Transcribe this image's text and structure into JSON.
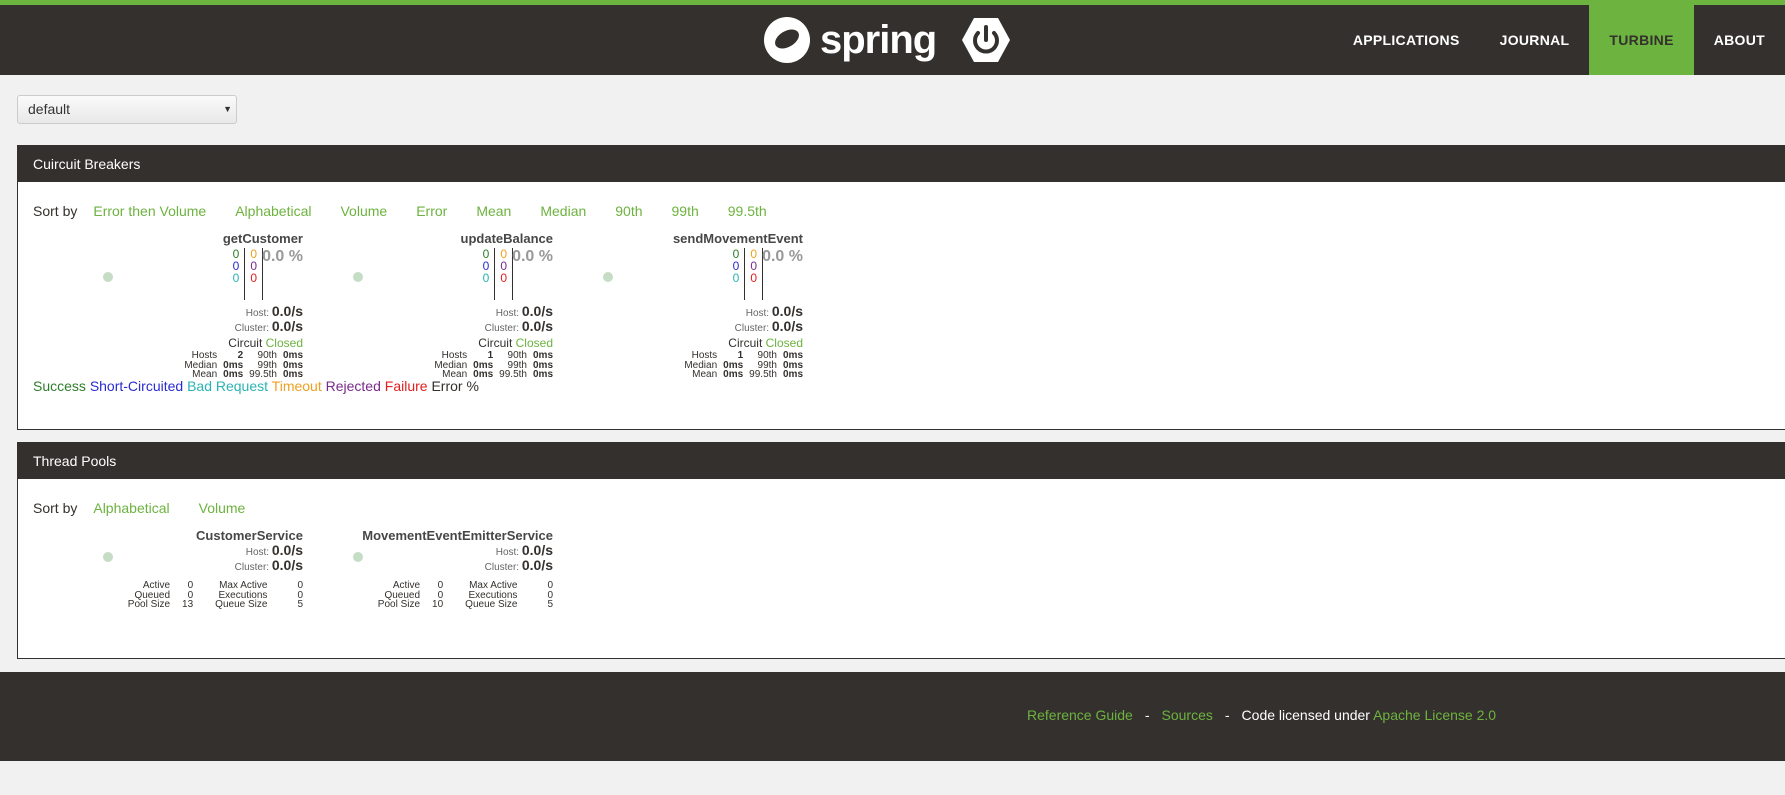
{
  "brand": {
    "name": "spring"
  },
  "nav": [
    {
      "label": "APPLICATIONS",
      "active": false
    },
    {
      "label": "JOURNAL",
      "active": false
    },
    {
      "label": "TURBINE",
      "active": true
    },
    {
      "label": "ABOUT",
      "active": false
    }
  ],
  "cluster_select": {
    "value": "default"
  },
  "circuit_breakers": {
    "title": "Cuircuit Breakers",
    "sort_label": "Sort by",
    "sort_options": [
      "Error then Volume",
      "Alphabetical",
      "Volume",
      "Error",
      "Mean",
      "Median",
      "90th",
      "99th",
      "99.5th"
    ],
    "items": [
      {
        "name": "getCustomer",
        "success": "0",
        "short_circuited": "0",
        "bad_request": "0",
        "timeout": "0",
        "rejected": "0",
        "failure": "0",
        "error_pct": "0.0 %",
        "host_label": "Host:",
        "host": "0.0/s",
        "cluster_label": "Cluster:",
        "cluster": "0.0/s",
        "circuit_label": "Circuit",
        "circuit_status": "Closed",
        "hosts": "2",
        "median": "0ms",
        "mean": "0ms",
        "p90": "0ms",
        "p99": "0ms",
        "p995": "0ms"
      },
      {
        "name": "updateBalance",
        "success": "0",
        "short_circuited": "0",
        "bad_request": "0",
        "timeout": "0",
        "rejected": "0",
        "failure": "0",
        "error_pct": "0.0 %",
        "host_label": "Host:",
        "host": "0.0/s",
        "cluster_label": "Cluster:",
        "cluster": "0.0/s",
        "circuit_label": "Circuit",
        "circuit_status": "Closed",
        "hosts": "1",
        "median": "0ms",
        "mean": "0ms",
        "p90": "0ms",
        "p99": "0ms",
        "p995": "0ms"
      },
      {
        "name": "sendMovementEvent",
        "success": "0",
        "short_circuited": "0",
        "bad_request": "0",
        "timeout": "0",
        "rejected": "0",
        "failure": "0",
        "error_pct": "0.0 %",
        "host_label": "Host:",
        "host": "0.0/s",
        "cluster_label": "Cluster:",
        "cluster": "0.0/s",
        "circuit_label": "Circuit",
        "circuit_status": "Closed",
        "hosts": "1",
        "median": "0ms",
        "mean": "0ms",
        "p90": "0ms",
        "p99": "0ms",
        "p995": "0ms"
      }
    ],
    "stat_labels": {
      "hosts": "Hosts",
      "median": "Median",
      "mean": "Mean",
      "p90": "90th",
      "p99": "99th",
      "p995": "99.5th"
    },
    "legend": [
      {
        "label": "Success",
        "color": "#2d7d2d"
      },
      {
        "label": "Short-Circuited",
        "color": "#2b2bd0"
      },
      {
        "label": "Bad Request",
        "color": "#2bb3b3"
      },
      {
        "label": "Timeout",
        "color": "#f0a020"
      },
      {
        "label": "Rejected",
        "color": "#7a2a8a"
      },
      {
        "label": "Failure",
        "color": "#e02020"
      },
      {
        "label": "Error %",
        "color": "#34302d"
      }
    ]
  },
  "thread_pools": {
    "title": "Thread Pools",
    "sort_label": "Sort by",
    "sort_options": [
      "Alphabetical",
      "Volume"
    ],
    "stat_labels": {
      "active": "Active",
      "queued": "Queued",
      "pool_size": "Pool Size",
      "max_active": "Max Active",
      "executions": "Executions",
      "queue_size": "Queue Size"
    },
    "items": [
      {
        "name": "CustomerService",
        "host_label": "Host:",
        "host": "0.0/s",
        "cluster_label": "Cluster:",
        "cluster": "0.0/s",
        "active": "0",
        "queued": "0",
        "pool_size": "13",
        "max_active": "0",
        "executions": "0",
        "queue_size": "5"
      },
      {
        "name": "MovementEventEmitterService",
        "host_label": "Host:",
        "host": "0.0/s",
        "cluster_label": "Cluster:",
        "cluster": "0.0/s",
        "active": "0",
        "queued": "0",
        "pool_size": "10",
        "max_active": "0",
        "executions": "0",
        "queue_size": "5"
      }
    ]
  },
  "footer": {
    "reference_guide": "Reference Guide",
    "sep": "-",
    "sources": "Sources",
    "license_text": "Code licensed under",
    "license_link": "Apache License 2.0"
  }
}
